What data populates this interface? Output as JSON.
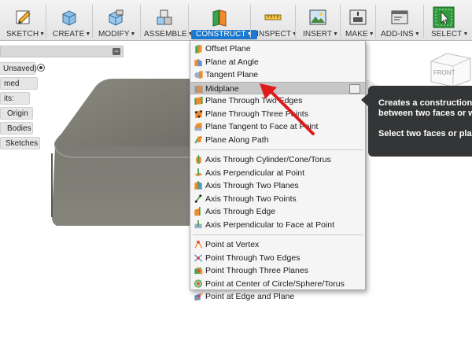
{
  "toolbar": {
    "sketch": "SKETCH",
    "create": "CREATE",
    "modify": "MODIFY",
    "assemble": "ASSEMBLE",
    "construct": "CONSTRUCT",
    "inspect": "INSPECT",
    "insert": "INSERT",
    "make": "MAKE",
    "addins": "ADD-INS",
    "select": "SELECT",
    "caret": "▼"
  },
  "browser": {
    "unsaved": "Unsaved)",
    "named_views": "med Views",
    "units": "its: mm",
    "origin": "Origin",
    "bodies": "Bodies",
    "sketches": "Sketches",
    "collapse": "−"
  },
  "construct_menu": {
    "planes": [
      {
        "label": "Offset Plane",
        "icon": "offset-plane-icon"
      },
      {
        "label": "Plane at Angle",
        "icon": "plane-at-angle-icon"
      },
      {
        "label": "Tangent Plane",
        "icon": "tangent-plane-icon"
      },
      {
        "label": "Midplane",
        "icon": "midplane-icon"
      },
      {
        "label": "Plane Through Two Edges",
        "icon": "plane-two-edges-icon"
      },
      {
        "label": "Plane Through Three Points",
        "icon": "plane-three-points-icon"
      },
      {
        "label": "Plane Tangent to Face at Point",
        "icon": "plane-tangent-face-icon"
      },
      {
        "label": "Plane Along Path",
        "icon": "plane-along-path-icon"
      }
    ],
    "axes": [
      {
        "label": "Axis Through Cylinder/Cone/Torus",
        "icon": "axis-cylinder-icon"
      },
      {
        "label": "Axis Perpendicular at Point",
        "icon": "axis-perpendicular-icon"
      },
      {
        "label": "Axis Through Two Planes",
        "icon": "axis-two-planes-icon"
      },
      {
        "label": "Axis Through Two Points",
        "icon": "axis-two-points-icon"
      },
      {
        "label": "Axis Through Edge",
        "icon": "axis-edge-icon"
      },
      {
        "label": "Axis Perpendicular to Face at Point",
        "icon": "axis-perp-face-icon"
      }
    ],
    "points": [
      {
        "label": "Point at Vertex",
        "icon": "point-vertex-icon"
      },
      {
        "label": "Point Through Two Edges",
        "icon": "point-two-edges-icon"
      },
      {
        "label": "Point Through Three Planes",
        "icon": "point-three-planes-icon"
      },
      {
        "label": "Point at Center of Circle/Sphere/Torus",
        "icon": "point-center-icon"
      },
      {
        "label": "Point at Edge and Plane",
        "icon": "point-edge-plane-icon"
      }
    ]
  },
  "tooltip": {
    "line1": "Creates a construction p",
    "line2": "between two faces or w",
    "line3": "Select two faces or plan"
  },
  "viewcube": {
    "face": "FRONT"
  },
  "colors": {
    "accent": "#1d78d0",
    "body": "#7f7f76",
    "arrow": "#e01b1b"
  }
}
